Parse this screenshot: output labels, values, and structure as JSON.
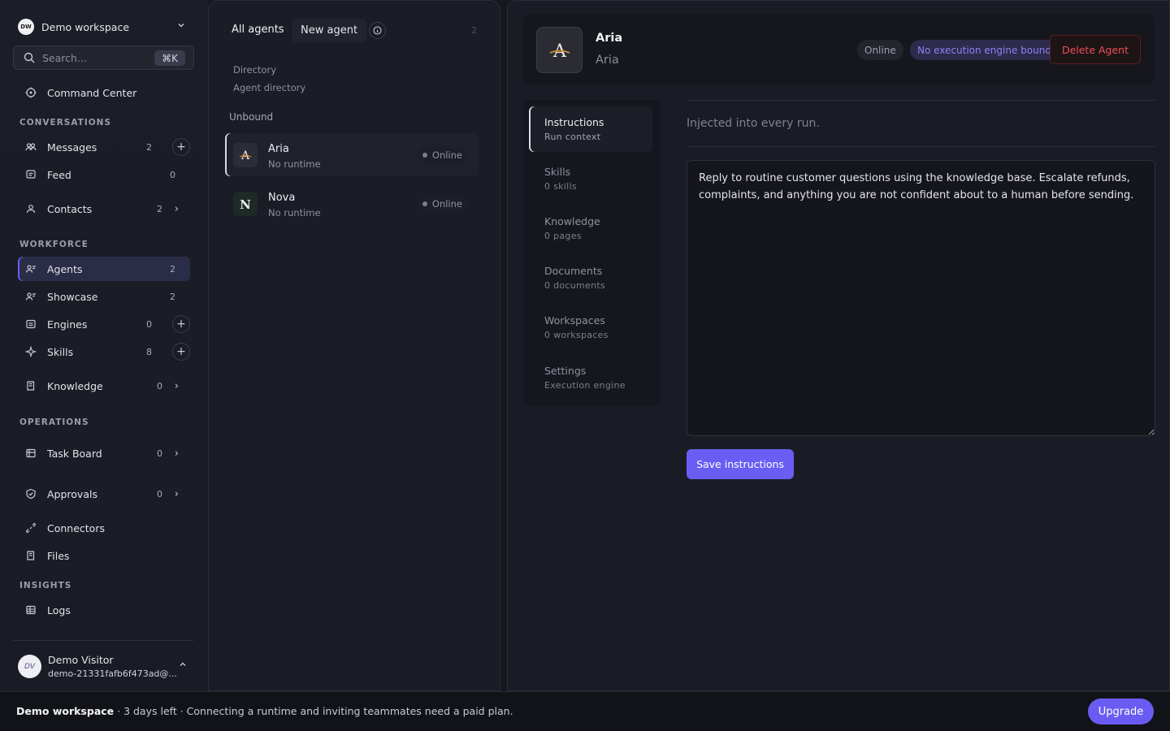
{
  "workspace": {
    "logo_text": "DW",
    "name": "Demo workspace"
  },
  "search": {
    "placeholder": "Search...",
    "shortcut": "⌘K"
  },
  "sidebar": {
    "command_center": "Command Center",
    "sections": {
      "conversations": "CONVERSATIONS",
      "workforce": "WORKFORCE",
      "operations": "OPERATIONS",
      "insights": "INSIGHTS"
    },
    "items": {
      "messages": {
        "label": "Messages",
        "count": "2"
      },
      "feed": {
        "label": "Feed",
        "count": "0"
      },
      "contacts": {
        "label": "Contacts",
        "count": "2"
      },
      "agents": {
        "label": "Agents",
        "count": "2"
      },
      "showcase": {
        "label": "Showcase",
        "count": "2"
      },
      "engines": {
        "label": "Engines",
        "count": "0"
      },
      "skills": {
        "label": "Skills",
        "count": "8"
      },
      "knowledge": {
        "label": "Knowledge",
        "count": "0"
      },
      "task_board": {
        "label": "Task Board",
        "count": "0"
      },
      "approvals": {
        "label": "Approvals",
        "count": "0"
      },
      "connectors": {
        "label": "Connectors"
      },
      "files": {
        "label": "Files"
      },
      "logs": {
        "label": "Logs"
      }
    },
    "icons": [
      "target-icon",
      "people-icon",
      "feed-icon",
      "contact-icon",
      "agents-icon",
      "showcase-icon",
      "engine-icon",
      "sparkle-icon",
      "book-icon",
      "board-icon",
      "shield-check-icon",
      "link-icon",
      "file-icon",
      "grid-icon",
      "plus-icon",
      "chevron-right-icon"
    ]
  },
  "user": {
    "initials": "DV",
    "name": "Demo Visitor",
    "email": "demo-21331fafb6f473ad@..."
  },
  "agent_list": {
    "tab_all": "All agents",
    "tab_new": "New agent",
    "count": "2",
    "directory_title": "Directory",
    "directory_subtitle": "Agent directory",
    "group_label": "Unbound",
    "agents": [
      {
        "name": "Aria",
        "sub": "No runtime",
        "status": "Online",
        "logo": "A"
      },
      {
        "name": "Nova",
        "sub": "No runtime",
        "status": "Online",
        "logo": "N"
      }
    ]
  },
  "detail": {
    "name": "Aria",
    "subtitle": "Aria",
    "logo": "A",
    "status_badge": "Online",
    "engine_badge": "No execution engine bound",
    "delete_label": "Delete Agent",
    "subnav": [
      {
        "title": "Instructions",
        "sub": "Run context"
      },
      {
        "title": "Skills",
        "sub": "0 skills"
      },
      {
        "title": "Knowledge",
        "sub": "0 pages"
      },
      {
        "title": "Documents",
        "sub": "0 documents"
      },
      {
        "title": "Workspaces",
        "sub": "0 workspaces"
      },
      {
        "title": "Settings",
        "sub": "Execution engine"
      }
    ],
    "description": "Injected into every run.",
    "instructions": "Reply to routine customer questions using the knowledge base. Escalate refunds, complaints, and anything you are not confident about to a human before sending.",
    "save_label": "Save instructions"
  },
  "footer": {
    "workspace": "Demo workspace",
    "message": " · 3 days left · Connecting a runtime and inviting teammates need a paid plan.",
    "upgrade_label": "Upgrade"
  },
  "colors": {
    "accent": "#6a5cf2",
    "danger": "#ea5059",
    "engine_badge_text": "#8c83f5"
  }
}
